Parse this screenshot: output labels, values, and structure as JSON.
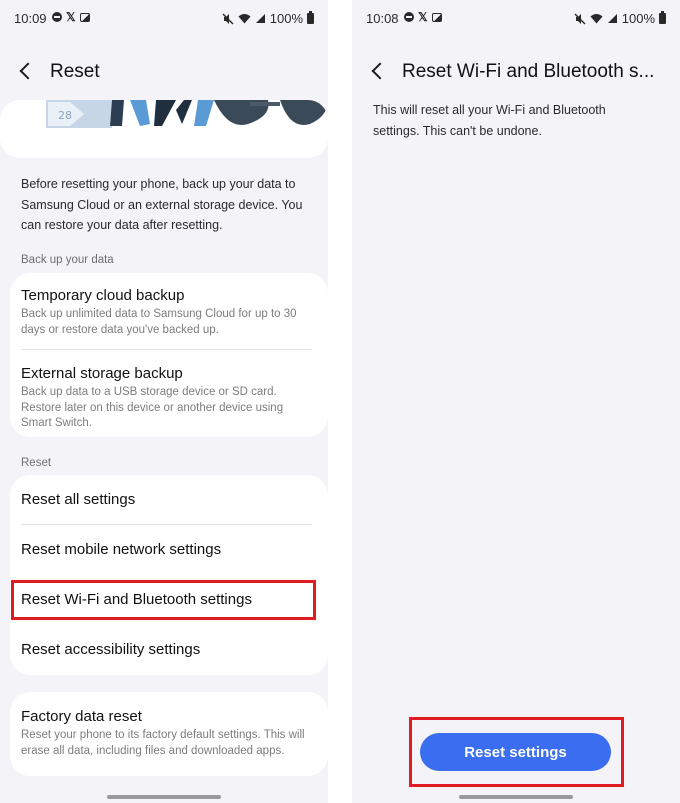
{
  "colors": {
    "highlight": "#e01b22",
    "primary_button": "#3a6df0",
    "panel_background": "#f4f3f8",
    "card_background": "#ffffff"
  },
  "left": {
    "status": {
      "time": "10:09",
      "battery": "100%"
    },
    "header": {
      "title": "Reset",
      "back_icon": "chevron-left-icon"
    },
    "intro_note": "Before resetting your phone, back up your data to Samsung Cloud or an external storage device. You can restore your data after resetting.",
    "backup_section": {
      "label": "Back up your data",
      "items": [
        {
          "title": "Temporary cloud backup",
          "subtitle": "Back up unlimited data to Samsung Cloud for up to 30 days or restore data you've backed up."
        },
        {
          "title": "External storage backup",
          "subtitle": "Back up data to a USB storage device or SD card. Restore later on this device or another device using Smart Switch."
        }
      ]
    },
    "reset_section": {
      "label": "Reset",
      "items": [
        {
          "title": "Reset all settings"
        },
        {
          "title": "Reset mobile network settings"
        },
        {
          "title": "Reset Wi-Fi and Bluetooth settings"
        },
        {
          "title": "Reset accessibility settings"
        }
      ]
    },
    "factory": {
      "title": "Factory data reset",
      "subtitle": "Reset your phone to its factory default settings. This will erase all data, including files and downloaded apps."
    },
    "illustration": {
      "badge": "28"
    }
  },
  "right": {
    "status": {
      "time": "10:08",
      "battery": "100%"
    },
    "header": {
      "title": "Reset Wi-Fi and Bluetooth s...",
      "back_icon": "chevron-left-icon"
    },
    "description": "This will reset all your Wi-Fi and Bluetooth settings. This can't be undone.",
    "button": {
      "label": "Reset settings"
    }
  }
}
